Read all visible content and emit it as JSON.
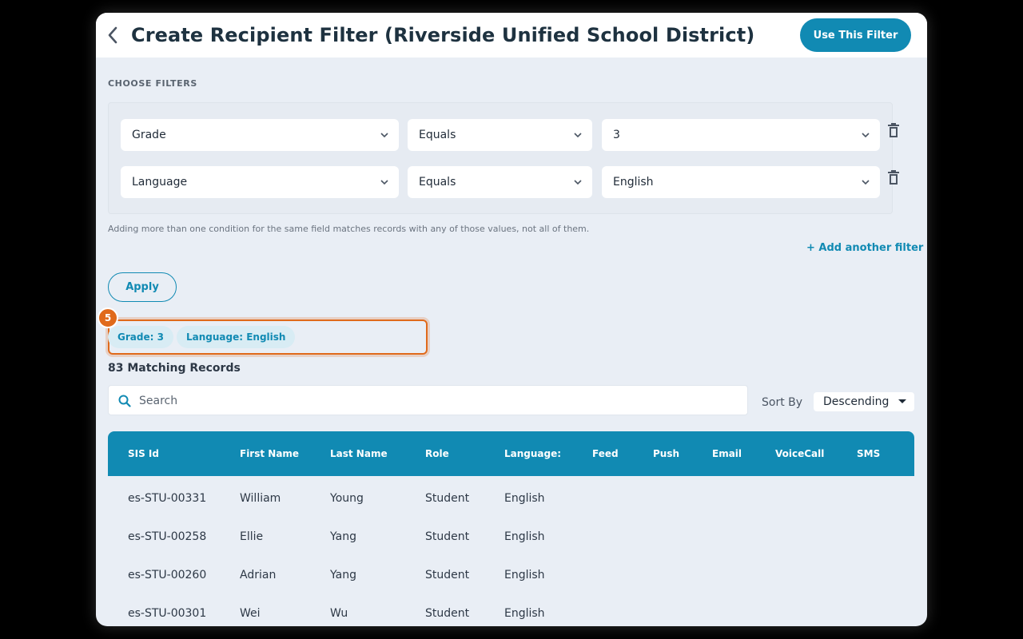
{
  "header": {
    "title": "Create Recipient Filter (Riverside Unified School District)",
    "use_filter_label": "Use This Filter"
  },
  "filters": {
    "section_label": "CHOOSE FILTERS",
    "rows": [
      {
        "field": "Grade",
        "operator": "Equals",
        "value": "3"
      },
      {
        "field": "Language",
        "operator": "Equals",
        "value": "English"
      }
    ],
    "hint": "Adding more than one condition for the same field matches records with any of those values, not all of them.",
    "add_label": "+ Add another filter",
    "apply_label": "Apply"
  },
  "chips": [
    "Grade: 3",
    "Language: English"
  ],
  "badge": "5",
  "results": {
    "match_count": "83 Matching Records",
    "search_placeholder": "Search",
    "sort_label": "Sort By",
    "sort_value": "Descending"
  },
  "table": {
    "columns": [
      "SIS Id",
      "First Name",
      "Last Name",
      "Role",
      "Language:",
      "Feed",
      "Push",
      "Email",
      "VoiceCall",
      "SMS"
    ],
    "rows": [
      [
        "es-STU-00331",
        "William",
        "Young",
        "Student",
        "English"
      ],
      [
        "es-STU-00258",
        "Ellie",
        "Yang",
        "Student",
        "English"
      ],
      [
        "es-STU-00260",
        "Adrian",
        "Yang",
        "Student",
        "English"
      ],
      [
        "es-STU-00301",
        "Wei",
        "Wu",
        "Student",
        "English"
      ]
    ]
  },
  "colors": {
    "accent": "#118ab3",
    "highlight": "#e06a1b",
    "title": "#1e3240"
  },
  "icons": {
    "back": "chevron-left-icon",
    "dropdown": "chevron-down-icon",
    "delete": "trash-icon",
    "search": "search-icon",
    "sort": "caret-down-icon"
  }
}
